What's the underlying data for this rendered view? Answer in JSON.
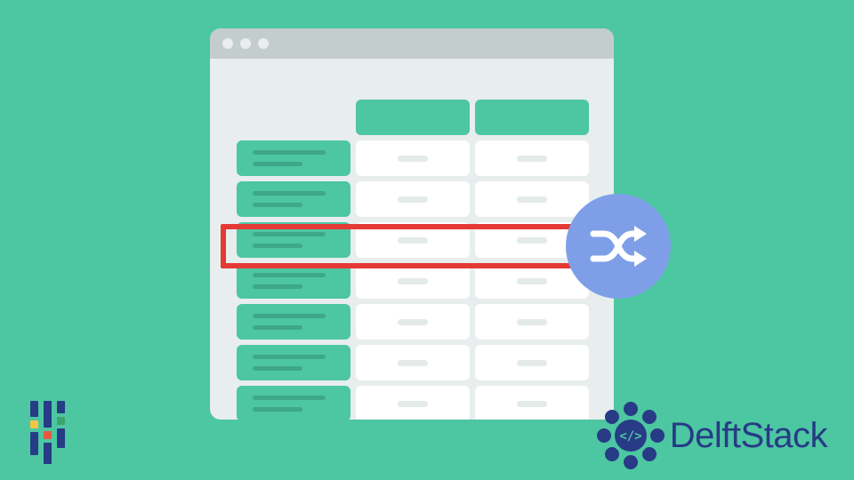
{
  "brand": {
    "name": "DelftStack"
  },
  "icons": {
    "shuffle": "shuffle-icon",
    "code": "code-icon"
  },
  "colors": {
    "bg": "#4DC6A2",
    "accent": "#3FA889",
    "badge": "#7E9FE8",
    "highlight": "#E53935",
    "brand": "#273B86"
  }
}
